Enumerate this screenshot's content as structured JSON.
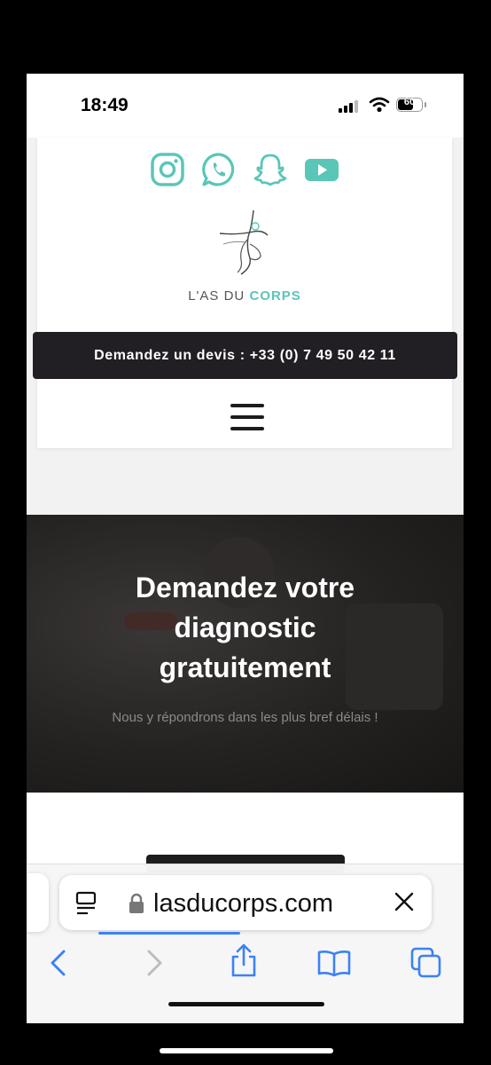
{
  "status_bar": {
    "time": "18:49",
    "battery_level": "60"
  },
  "header": {
    "social_icons": [
      "instagram-icon",
      "whatsapp-icon",
      "snapchat-icon",
      "youtube-icon"
    ],
    "logo": {
      "prefix": "L'AS DU ",
      "accent": "CORPS"
    },
    "quote_bar": "Demandez un devis : +33 (0) 7 49 50 42 11",
    "menu_icon": "hamburger-menu-icon"
  },
  "hero": {
    "title_line1": "Demandez votre",
    "title_line2": "diagnostic",
    "title_line3": "gratuitement",
    "subtitle": "Nous y répondrons dans les plus bref délais !"
  },
  "browser": {
    "url": "lasducorps.com",
    "toolbar_icons": [
      "back-icon",
      "forward-icon",
      "share-icon",
      "bookmarks-icon",
      "tabs-icon"
    ]
  },
  "colors": {
    "accent": "#5ac6b8",
    "dark_bar": "#221f24",
    "link_blue": "#3b82f6"
  }
}
